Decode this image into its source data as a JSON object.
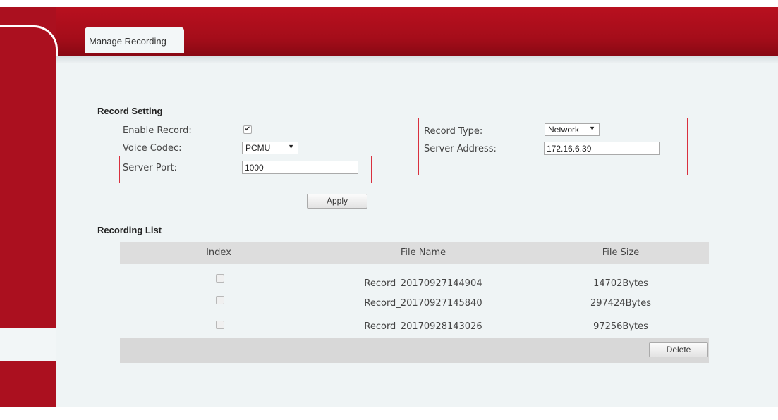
{
  "tab": {
    "label": "Manage Recording"
  },
  "record_setting": {
    "title": "Record Setting",
    "enable_record_label": "Enable Record:",
    "enable_record_checked": "✔",
    "voice_codec_label": "Voice Codec:",
    "voice_codec_value": "PCMU",
    "server_port_label": "Server Port:",
    "server_port_value": "1000",
    "record_type_label": "Record Type:",
    "record_type_value": "Network",
    "server_address_label": "Server Address:",
    "server_address_value": "172.16.6.39",
    "apply_label": "Apply"
  },
  "recording_list": {
    "title": "Recording List",
    "columns": [
      "Index",
      "File Name",
      "File Size"
    ],
    "rows": [
      {
        "file_name": "Record_20170927144904",
        "file_size": "14702Bytes"
      },
      {
        "file_name": "Record_20170927145840",
        "file_size": "297424Bytes"
      },
      {
        "file_name": "Record_20170928143026",
        "file_size": "97256Bytes"
      }
    ],
    "delete_label": "Delete"
  },
  "icons": {
    "dropdown": "chevron-down-icon",
    "checkbox": "checkbox-icon"
  },
  "colors": {
    "brand_red": "#ab101f",
    "highlight_box": "#d9303e",
    "content_bg": "#eff4f5"
  }
}
